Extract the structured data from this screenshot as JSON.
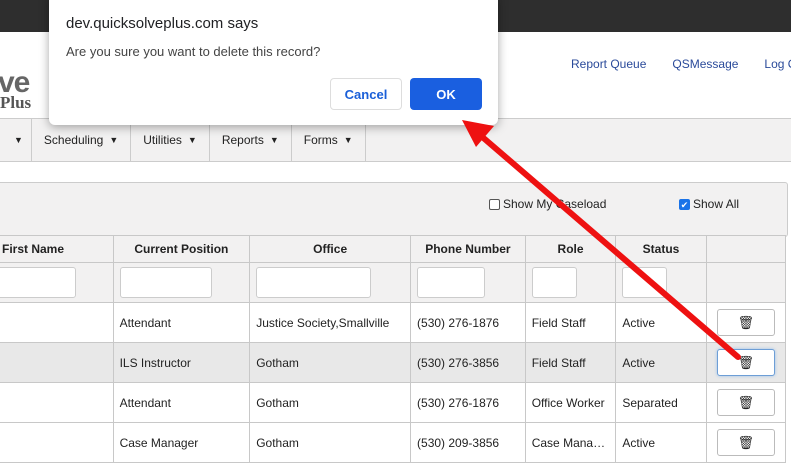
{
  "dialog": {
    "title": "dev.quicksolveplus.com says",
    "message": "Are you sure you want to delete this record?",
    "cancel_label": "Cancel",
    "ok_label": "OK"
  },
  "logo": {
    "line1": "ve",
    "line2": "Plus"
  },
  "header": {
    "links": [
      "Report Queue",
      "QSMessage",
      "Log O"
    ]
  },
  "menu": {
    "items": [
      "Scheduling",
      "Utilities",
      "Reports",
      "Forms"
    ],
    "caret": "▼"
  },
  "filters": {
    "show_my_caseload": {
      "label": "Show My Caseload",
      "checked": false
    },
    "show_all": {
      "label": "Show All",
      "checked": true
    }
  },
  "table": {
    "columns": [
      "First Name",
      "Current Position",
      "Office",
      "Phone Number",
      "Role",
      "Status",
      ""
    ],
    "rows": [
      {
        "first_name": "",
        "position": "Attendant",
        "office": "Justice Society,Smallville",
        "phone": "(530) 276-1876",
        "role": "Field Staff",
        "status": "Active"
      },
      {
        "first_name": "",
        "position": "ILS Instructor",
        "office": "Gotham",
        "phone": "(530) 276-3856",
        "role": "Field Staff",
        "status": "Active"
      },
      {
        "first_name": "",
        "position": "Attendant",
        "office": "Gotham",
        "phone": "(530) 276-1876",
        "role": "Office Worker",
        "status": "Separated"
      },
      {
        "first_name": "",
        "position": "Case Manager",
        "office": "Gotham",
        "phone": "(530) 209-3856",
        "role": "Case Mana…",
        "status": "Active"
      }
    ],
    "delete_icon": "trash-icon"
  },
  "colors": {
    "accent": "#1a5fe0",
    "annotation_arrow": "#ee1111"
  }
}
